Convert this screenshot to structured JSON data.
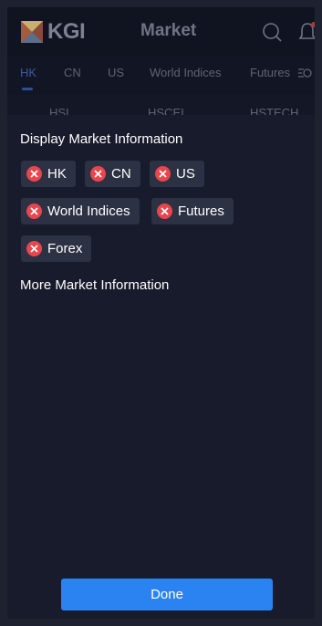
{
  "header": {
    "brand": "KGI",
    "title": "Market",
    "search_icon": "search-icon",
    "notification_icon": "bell-icon"
  },
  "tabs": [
    {
      "label": "HK",
      "active": true
    },
    {
      "label": "CN"
    },
    {
      "label": "US"
    },
    {
      "label": "World Indices"
    },
    {
      "label": "Futures"
    }
  ],
  "indices": [
    "HSI",
    "HSCEI",
    "HSTECH"
  ],
  "panel": {
    "display_title": "Display Market Information",
    "display_items": [
      "HK",
      "CN",
      "US",
      "World Indices",
      "Futures",
      "Forex"
    ],
    "more_title": "More Market Information",
    "done_label": "Done"
  },
  "colors": {
    "accent": "#2b83f2",
    "remove": "#e8454c",
    "chip_bg": "#2c3143",
    "background": "#171b2b"
  }
}
